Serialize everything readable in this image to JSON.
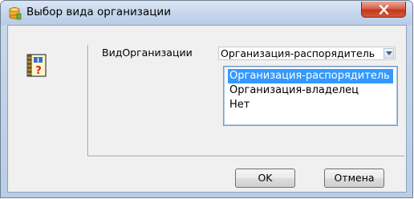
{
  "window": {
    "title": "Выбор вида организации",
    "title_icon": "database-icon",
    "close_icon": "close-icon"
  },
  "form": {
    "help_icon": "help-book-icon",
    "field_label": "ВидОрганизации",
    "combo_value": "Организация-распорядитель",
    "dropdown_options": [
      "Организация-распорядитель",
      "Организация-владелец",
      "Нет"
    ],
    "selected_index": 0
  },
  "buttons": {
    "ok": "OK",
    "cancel": "Отмена"
  },
  "colors": {
    "selection": "#3399ff",
    "close_button": "#c2391d",
    "titlebar": "#c6d7ec"
  }
}
